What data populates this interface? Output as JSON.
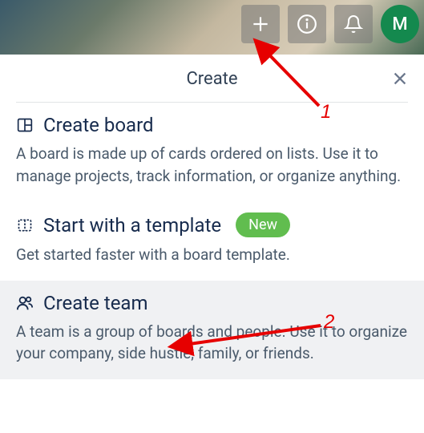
{
  "header": {
    "avatar_initial": "M"
  },
  "popup": {
    "title": "Create",
    "options": {
      "board": {
        "title": "Create board",
        "description": "A board is made up of cards ordered on lists. Use it to manage projects, track information, or organize anything."
      },
      "template": {
        "title": "Start with a template",
        "badge": "New",
        "description": "Get started faster with a board template."
      },
      "team": {
        "title": "Create team",
        "description": "A team is a group of boards and people. Use it to organize your company, side hustle, family, or friends."
      }
    }
  },
  "annotations": {
    "label1": "1",
    "label2": "2"
  }
}
